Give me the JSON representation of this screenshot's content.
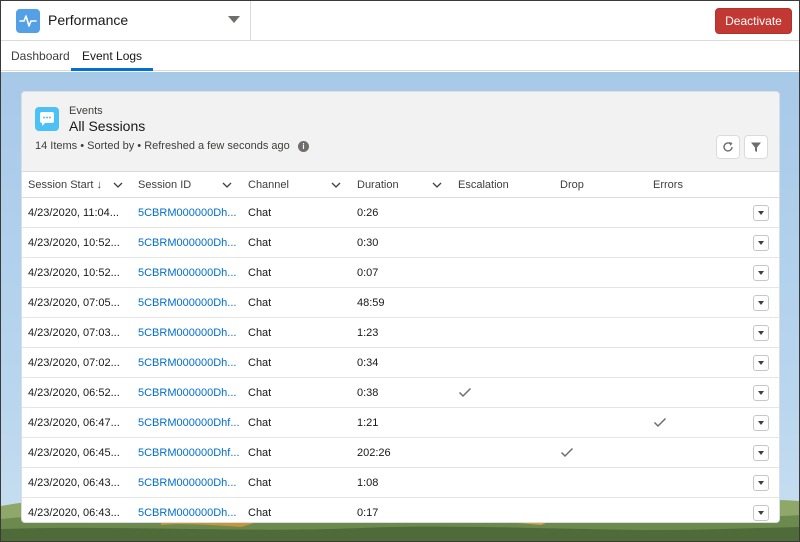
{
  "app": {
    "name": "Performance",
    "icon": "pulse-icon",
    "accent": "#54a0e6"
  },
  "header": {
    "deactivate_label": "Deactivate",
    "deactivate_color": "#c23934"
  },
  "tabs": [
    {
      "label": "Dashboard",
      "active": false
    },
    {
      "label": "Event Logs",
      "active": true
    }
  ],
  "list": {
    "object_label": "Events",
    "title": "All Sessions",
    "meta": "14 Items • Sorted by • Refreshed a few seconds ago",
    "icon": "chat-bubble-icon"
  },
  "columns": [
    {
      "label": "Session Start",
      "sorted": "desc"
    },
    {
      "label": "Session ID"
    },
    {
      "label": "Channel"
    },
    {
      "label": "Duration"
    },
    {
      "label": "Escalation"
    },
    {
      "label": "Drop"
    },
    {
      "label": "Errors"
    }
  ],
  "rows": [
    {
      "start": "4/23/2020, 11:04...",
      "session_id": "5CBRM000000Dh...",
      "channel": "Chat",
      "duration": "0:26",
      "escalation": false,
      "drop": false,
      "errors": false
    },
    {
      "start": "4/23/2020, 10:52...",
      "session_id": "5CBRM000000Dh...",
      "channel": "Chat",
      "duration": "0:30",
      "escalation": false,
      "drop": false,
      "errors": false
    },
    {
      "start": "4/23/2020, 10:52...",
      "session_id": "5CBRM000000Dh...",
      "channel": "Chat",
      "duration": "0:07",
      "escalation": false,
      "drop": false,
      "errors": false
    },
    {
      "start": "4/23/2020, 07:05...",
      "session_id": "5CBRM000000Dh...",
      "channel": "Chat",
      "duration": "48:59",
      "escalation": false,
      "drop": false,
      "errors": false
    },
    {
      "start": "4/23/2020, 07:03...",
      "session_id": "5CBRM000000Dh...",
      "channel": "Chat",
      "duration": "1:23",
      "escalation": false,
      "drop": false,
      "errors": false
    },
    {
      "start": "4/23/2020, 07:02...",
      "session_id": "5CBRM000000Dh...",
      "channel": "Chat",
      "duration": "0:34",
      "escalation": false,
      "drop": false,
      "errors": false
    },
    {
      "start": "4/23/2020, 06:52...",
      "session_id": "5CBRM000000Dh...",
      "channel": "Chat",
      "duration": "0:38",
      "escalation": true,
      "drop": false,
      "errors": false
    },
    {
      "start": "4/23/2020, 06:47...",
      "session_id": "5CBRM000000Dhf...",
      "channel": "Chat",
      "duration": "1:21",
      "escalation": false,
      "drop": false,
      "errors": true
    },
    {
      "start": "4/23/2020, 06:45...",
      "session_id": "5CBRM000000Dhf...",
      "channel": "Chat",
      "duration": "202:26",
      "escalation": false,
      "drop": true,
      "errors": false
    },
    {
      "start": "4/23/2020, 06:43...",
      "session_id": "5CBRM000000Dh...",
      "channel": "Chat",
      "duration": "1:08",
      "escalation": false,
      "drop": false,
      "errors": false
    },
    {
      "start": "4/23/2020, 06:43...",
      "session_id": "5CBRM000000Dh...",
      "channel": "Chat",
      "duration": "0:17",
      "escalation": false,
      "drop": false,
      "errors": false
    }
  ]
}
